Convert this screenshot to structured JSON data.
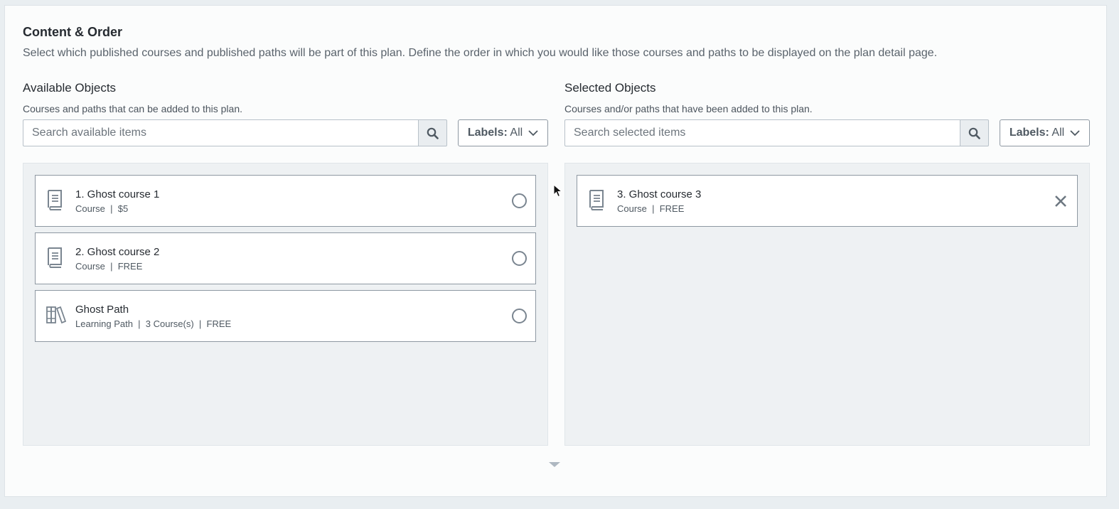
{
  "section": {
    "title": "Content & Order",
    "description": "Select which published courses and published paths will be part of this plan. Define the order in which you would like those courses and paths to be displayed on the plan detail page."
  },
  "available": {
    "title": "Available Objects",
    "subtitle": "Courses and paths that can be added to this plan.",
    "search_placeholder": "Search available items",
    "labels_key": "Labels:",
    "labels_value": "All",
    "items": [
      {
        "name": "1. Ghost course 1",
        "meta": "Course  |  $5",
        "icon": "book-icon"
      },
      {
        "name": "2. Ghost course 2",
        "meta": "Course  |  FREE",
        "icon": "book-icon"
      },
      {
        "name": "Ghost Path",
        "meta": "Learning Path  |  3 Course(s)  |  FREE",
        "icon": "library-books-icon"
      }
    ]
  },
  "selected": {
    "title": "Selected Objects",
    "subtitle": "Courses and/or paths that have been added to this plan.",
    "search_placeholder": "Search selected items",
    "labels_key": "Labels:",
    "labels_value": "All",
    "items": [
      {
        "name": "3. Ghost course 3",
        "meta": "Course  |  FREE",
        "icon": "book-icon"
      }
    ]
  },
  "colors": {
    "background": "#e9eef1",
    "card": "#fbfcfc",
    "list_bg": "#eef1f3",
    "border": "#8e98a2",
    "icon": "#7a8590"
  }
}
